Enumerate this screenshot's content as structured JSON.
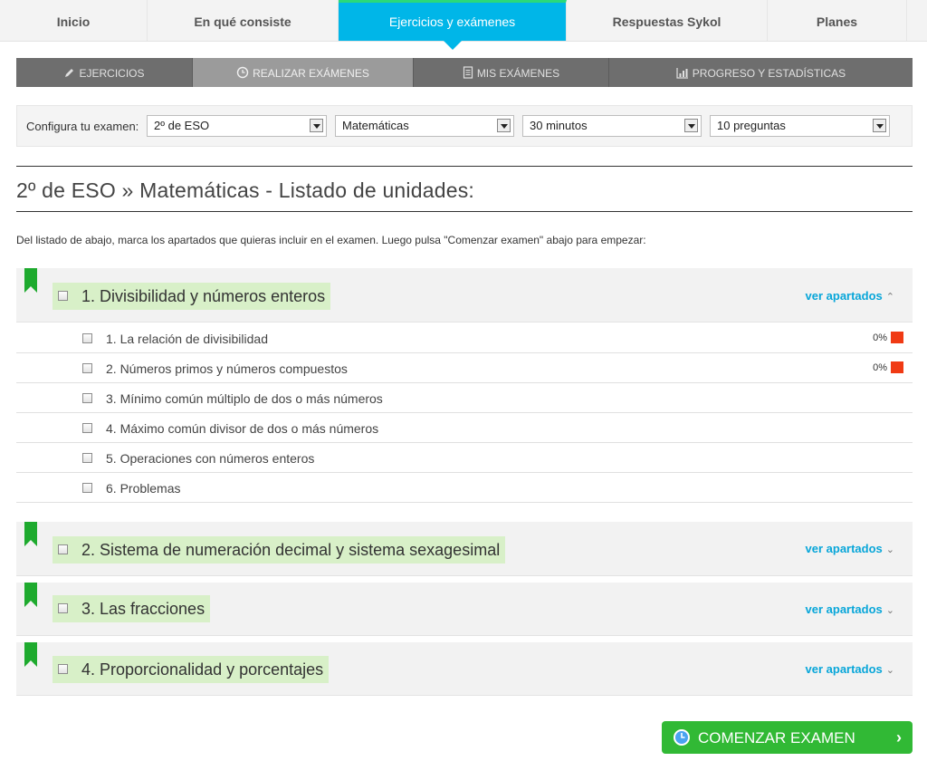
{
  "top_nav": [
    {
      "label": "Inicio"
    },
    {
      "label": "En qué consiste"
    },
    {
      "label": "Ejercicios y exámenes"
    },
    {
      "label": "Respuestas Sykol"
    },
    {
      "label": "Planes"
    }
  ],
  "sub_nav": [
    {
      "label": "EJERCICIOS",
      "icon": "pencil-icon"
    },
    {
      "label": "REALIZAR EXÁMENES",
      "icon": "clock-icon"
    },
    {
      "label": "MIS EXÁMENES",
      "icon": "document-icon"
    },
    {
      "label": "PROGRESO Y ESTADÍSTICAS",
      "icon": "chart-icon"
    }
  ],
  "config": {
    "label": "Configura tu examen:",
    "course": "2º de ESO",
    "subject": "Matemáticas",
    "duration": "30 minutos",
    "questions": "10 preguntas"
  },
  "page_title": "2º de ESO » Matemáticas - Listado de unidades:",
  "instructions": "Del listado de abajo, marca los apartados que quieras incluir en el examen. Luego pulsa \"Comenzar examen\" abajo para empezar:",
  "units": [
    {
      "title": "1. Divisibilidad y números enteros",
      "toggle": "ver apartados",
      "expanded": true
    },
    {
      "title": "2. Sistema de numeración decimal y sistema sexagesimal",
      "toggle": "ver apartados",
      "expanded": false
    },
    {
      "title": "3. Las fracciones",
      "toggle": "ver apartados",
      "expanded": false
    },
    {
      "title": "4. Proporcionalidad y porcentajes",
      "toggle": "ver apartados",
      "expanded": false
    }
  ],
  "unit1_sections": [
    {
      "label": "1. La relación de divisibilidad",
      "progress": "0%"
    },
    {
      "label": "2. Números primos y números compuestos",
      "progress": "0%"
    },
    {
      "label": "3. Mínimo común múltiplo de dos o más números"
    },
    {
      "label": "4. Máximo común divisor de dos o más números"
    },
    {
      "label": "5. Operaciones con números enteros"
    },
    {
      "label": "6. Problemas"
    }
  ],
  "start_button": "COMENZAR EXAMEN",
  "colors": {
    "accent": "#00b6e8",
    "unit_highlight": "#d8f0c8",
    "button": "#31b935",
    "progress_marker": "#f03a14",
    "bookmark": "#1eaa2e"
  }
}
